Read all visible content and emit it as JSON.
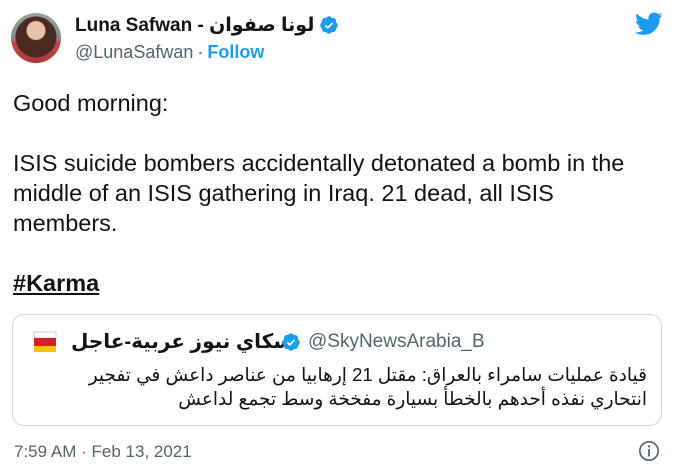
{
  "author": {
    "display_name": "Luna Safwan - لونا صفوان",
    "handle": "@LunaSafwan",
    "separator": "·",
    "follow_label": "Follow"
  },
  "tweet": {
    "text": "Good morning:\n\nISIS suicide bombers accidentally detonated a bomb in the middle of an ISIS gathering in Iraq. 21 dead, all ISIS members.\n\n",
    "hashtag": "#Karma"
  },
  "quote": {
    "display_name": "سكاي نيوز عربية-عاجل",
    "handle": "@SkyNewsArabia_B",
    "text": "قيادة عمليات سامراء بالعراق: مقتل 21 إرهابيا من عناصر داعش في تفجير انتحاري نفذه أحدهم بالخطأ بسيارة مفخخة وسط تجمع لداعش"
  },
  "footer": {
    "time": "7:59 AM",
    "separator": "·",
    "date": "Feb 13, 2021"
  },
  "colors": {
    "accent": "#1d9bf0",
    "muted": "#536471",
    "border": "#cfd9de"
  },
  "icons": [
    "verified-icon",
    "twitter-bird-icon",
    "sky-news-logo",
    "info-icon"
  ]
}
